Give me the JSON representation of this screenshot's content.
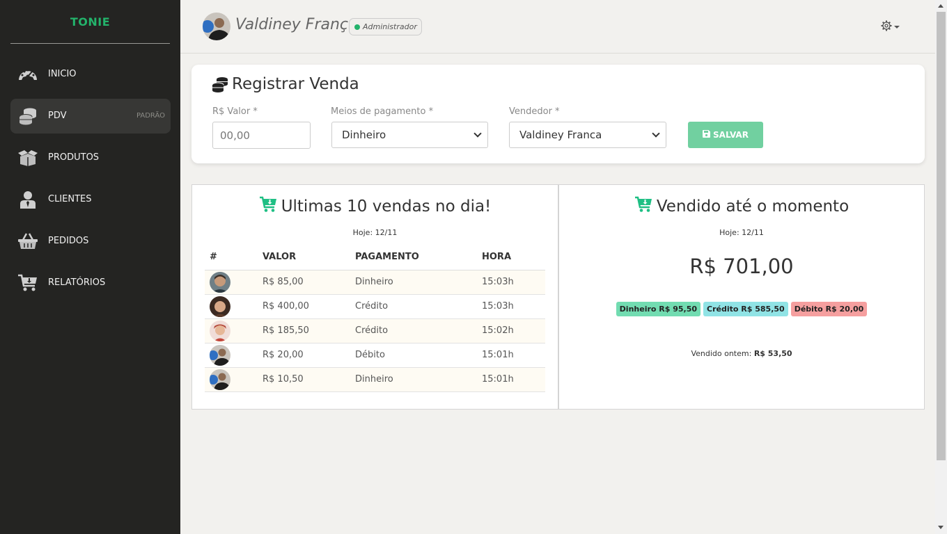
{
  "brand": "TONIE",
  "sidebar": {
    "items": [
      {
        "label": "INICIO",
        "icon": "dashboard-gauge-icon"
      },
      {
        "label": "PDV",
        "icon": "coins-icon",
        "badge": "PADRÃO",
        "active": true
      },
      {
        "label": "PRODUTOS",
        "icon": "box-open-icon"
      },
      {
        "label": "CLIENTES",
        "icon": "user-tie-icon"
      },
      {
        "label": "PEDIDOS",
        "icon": "basket-icon"
      },
      {
        "label": "RELATÓRIOS",
        "icon": "cart-arrow-down-icon"
      }
    ]
  },
  "header": {
    "user_name": "Valdiney França",
    "role": "Administrador",
    "status_color": "#23b36b",
    "settings_icon": "gear-icon"
  },
  "register": {
    "title": "Registrar Venda",
    "value_label": "R$ Valor *",
    "value_placeholder": "00,00",
    "payment_label": "Meios de pagamento *",
    "payment_selected": "Dinheiro",
    "seller_label": "Vendedor *",
    "seller_selected": "Valdiney Franca",
    "save_label": "SALVAR"
  },
  "last_sales": {
    "title": "Ultimas 10 vendas no dia!",
    "subtitle": "Hoje: 12/11",
    "columns": [
      "#",
      "VALOR",
      "PAGAMENTO",
      "HORA"
    ],
    "rows": [
      {
        "valor": "R$ 85,00",
        "pagamento": "Dinheiro",
        "hora": "15:03h"
      },
      {
        "valor": "R$ 400,00",
        "pagamento": "Crédito",
        "hora": "15:03h"
      },
      {
        "valor": "R$ 185,50",
        "pagamento": "Crédito",
        "hora": "15:02h"
      },
      {
        "valor": "R$ 20,00",
        "pagamento": "Débito",
        "hora": "15:01h"
      },
      {
        "valor": "R$ 10,50",
        "pagamento": "Dinheiro",
        "hora": "15:01h"
      }
    ]
  },
  "sold": {
    "title": "Vendido até o momento",
    "subtitle": "Hoje: 12/11",
    "total": "R$ 701,00",
    "badges": [
      {
        "label": "Dinheiro R$ 95,50",
        "color": "#72dcb1"
      },
      {
        "label": "Crédito R$ 585,50",
        "color": "#90e3e5"
      },
      {
        "label": "Débito R$ 20,00",
        "color": "#f59f9f"
      }
    ],
    "yesterday_label": "Vendido ontem:",
    "yesterday_value": "R$ 53,50"
  },
  "colors": {
    "accent": "#23b36b",
    "sidebar_bg": "#242422",
    "save_button": "#71d0a0",
    "cart_icon": "#1fbf84"
  }
}
